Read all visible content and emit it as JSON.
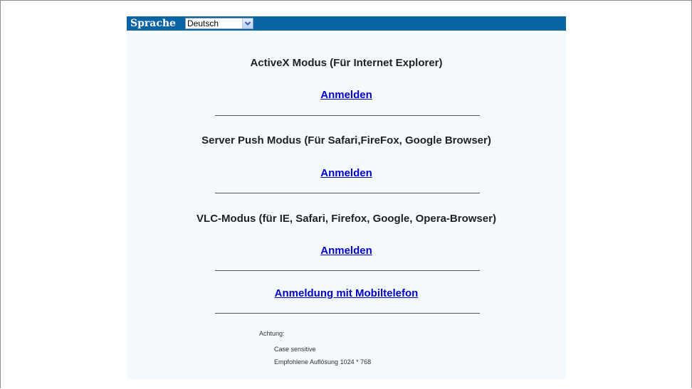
{
  "language_bar": {
    "label": "Sprache",
    "selected_language": "Deutsch"
  },
  "sections": [
    {
      "title": "ActiveX Modus (Für Internet Explorer)",
      "link": "Anmelden"
    },
    {
      "title": "Server Push Modus (Für Safari,FireFox, Google Browser)",
      "link": "Anmelden"
    },
    {
      "title": "VLC-Modus (für IE, Safari, Firefox, Google, Opera-Browser)",
      "link": "Anmelden"
    }
  ],
  "mobile_login": "Anmeldung mit Mobiltelefon",
  "notes": {
    "heading": "Achtung:",
    "items": [
      "Case sensitive",
      "Empfohlene Auflösung 1024 * 768"
    ]
  },
  "colors": {
    "header_bar": "#0a64a4",
    "panel_background": "#f4f9fd",
    "link": "#0000cc"
  }
}
